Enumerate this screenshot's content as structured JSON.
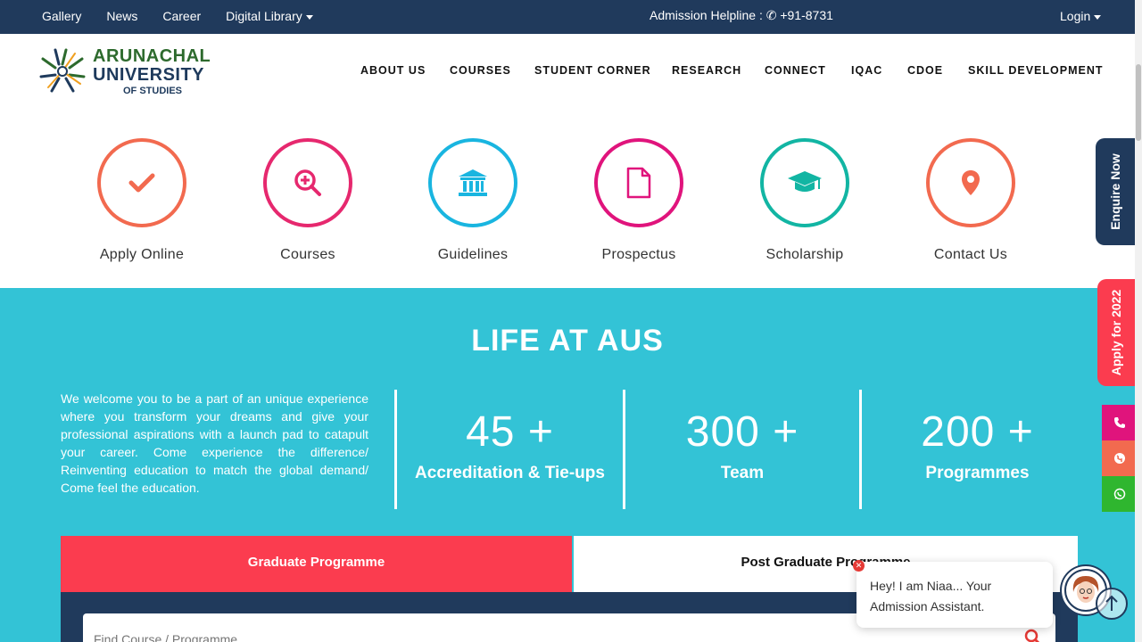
{
  "topbar": {
    "links": [
      "Gallery",
      "News",
      "Career",
      "Digital Library"
    ],
    "helpline_label": "Admission Helpline :",
    "helpline_number": "+91-8731",
    "login": "Login"
  },
  "logo": {
    "line1": "ARUNACHAL",
    "line2": "UNIVERSITY",
    "line3": "OF STUDIES"
  },
  "nav": [
    "ABOUT US",
    "COURSES",
    "STUDENT CORNER",
    "RESEARCH",
    "CONNECT",
    "IQAC",
    "CDOE",
    "SKILL DEVELOPMENT"
  ],
  "quick_links": [
    {
      "label": "Apply Online",
      "icon": "check-icon",
      "color": "#f26a4f"
    },
    {
      "label": "Courses",
      "icon": "zoom-in-icon",
      "color": "#e6286e"
    },
    {
      "label": "Guidelines",
      "icon": "institution-icon",
      "color": "#19b5e0"
    },
    {
      "label": "Prospectus",
      "icon": "document-icon",
      "color": "#e0147c"
    },
    {
      "label": "Scholarship",
      "icon": "graduation-cap-icon",
      "color": "#12b5a3"
    },
    {
      "label": "Contact Us",
      "icon": "map-pin-icon",
      "color": "#f26a4f"
    }
  ],
  "life": {
    "title": "LIFE AT AUS",
    "welcome": "We welcome you to be a part of an unique experience where you transform your dreams and give your professional aspirations with a launch pad to catapult your career. Come experience the difference/ Reinventing education to match the global demand/ Come feel the education.",
    "stats": [
      {
        "num": "45",
        "plus": "+",
        "label": "Accreditation & Tie-ups"
      },
      {
        "num": "300",
        "plus": "+",
        "label": "Team"
      },
      {
        "num": "200",
        "plus": "+",
        "label": "Programmes"
      }
    ]
  },
  "tabs": {
    "graduate": "Graduate Programme",
    "post_graduate": "Post Graduate Programme"
  },
  "search": {
    "placeholder": "Find Course / Programme"
  },
  "side": {
    "enquire": "Enquire Now",
    "apply": "Apply for 2022"
  },
  "chat": {
    "message": "Hey! I am Niaa... Your Admission Assistant."
  },
  "colors": {
    "navy": "#203a5c",
    "teal": "#33c3d6",
    "red": "#fb3c4f"
  }
}
